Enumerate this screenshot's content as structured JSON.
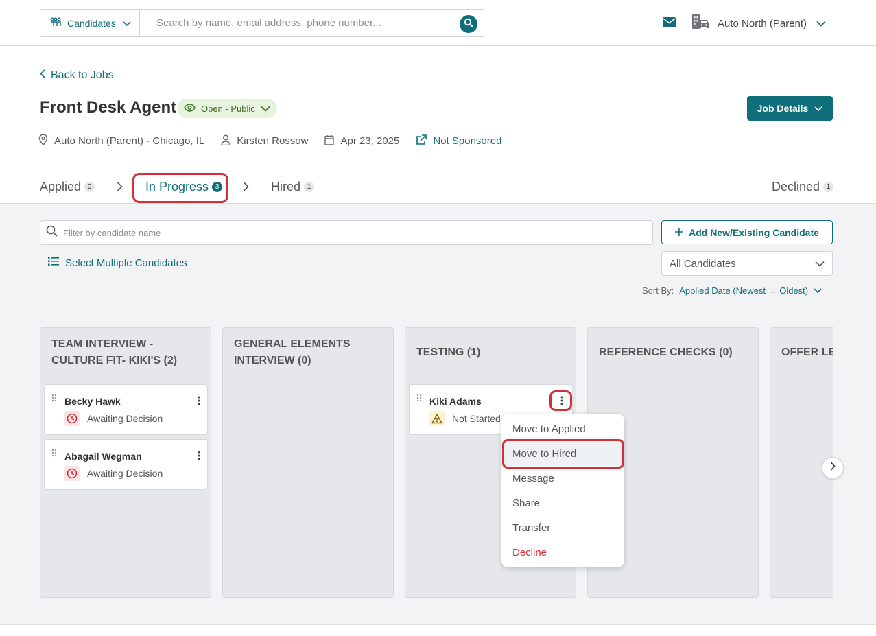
{
  "topbar": {
    "scope_label": "Candidates",
    "search_placeholder": "Search by name, email address, phone number...",
    "org_label": "Auto North (Parent)"
  },
  "header": {
    "back_label": "Back to Jobs",
    "job_title": "Front Desk Agent",
    "status_label": "Open - Public",
    "job_details_label": "Job Details",
    "location": "Auto North (Parent) - Chicago, IL",
    "recruiter": "Kirsten Rossow",
    "date": "Apr 23, 2025",
    "sponsor_link": "Not Sponsored"
  },
  "stages": {
    "applied": {
      "label": "Applied",
      "count": "0"
    },
    "in_progress": {
      "label": "In Progress",
      "count": "3"
    },
    "hired": {
      "label": "Hired",
      "count": "1"
    },
    "declined": {
      "label": "Declined",
      "count": "1"
    }
  },
  "toolbar": {
    "filter_placeholder": "Filter by candidate name",
    "add_label": "Add New/Existing Candidate",
    "select_multiple_label": "Select Multiple Candidates",
    "candidates_filter": "All Candidates",
    "sort_label": "Sort By:",
    "sort_value": "Applied Date (Newest → Oldest)"
  },
  "columns": [
    {
      "title": "TEAM INTERVIEW - CULTURE FIT- KIKI'S (2)"
    },
    {
      "title": "GENERAL ELEMENTS INTERVIEW (0)"
    },
    {
      "title": "TESTING (1)"
    },
    {
      "title": "REFERENCE CHECKS (0)"
    },
    {
      "title": "OFFER LETTER"
    }
  ],
  "cards": [
    {
      "name": "Becky Hawk",
      "status": "Awaiting Decision"
    },
    {
      "name": "Abagail Wegman",
      "status": "Awaiting Decision"
    },
    {
      "name": "Kiki Adams",
      "status": "Not Started"
    }
  ],
  "menu": {
    "items": [
      "Move to Applied",
      "Move to Hired",
      "Message",
      "Share",
      "Transfer",
      "Decline"
    ]
  },
  "colors": {
    "brand": "#0f6e7a",
    "highlight_ring": "#d32f3a",
    "status_pill_bg": "#e8f3dd"
  }
}
